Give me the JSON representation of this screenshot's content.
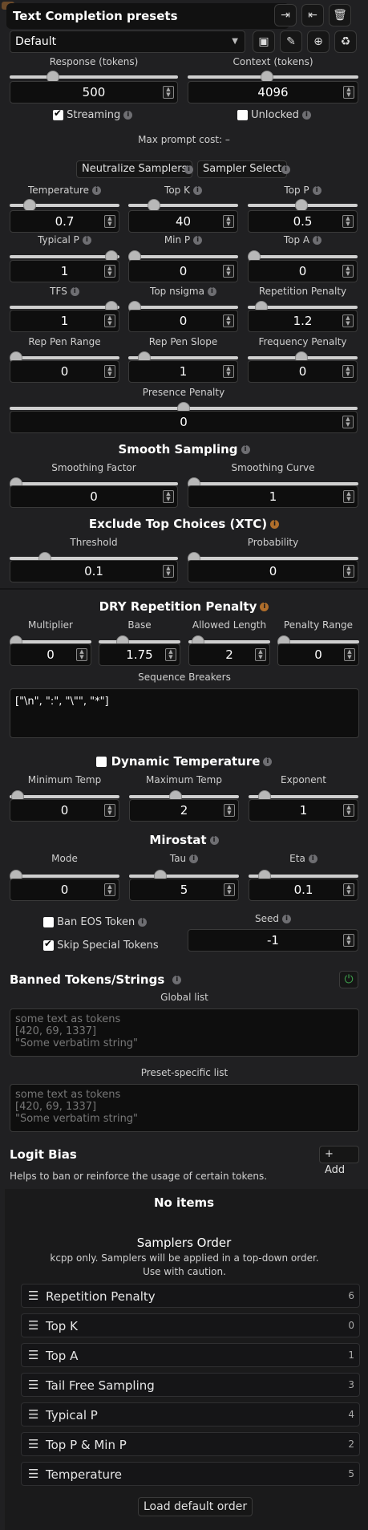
{
  "header": {
    "title": "Text Completion presets",
    "icons": [
      "import-icon",
      "export-icon",
      "trash-icon"
    ]
  },
  "preset": {
    "selected": "Default",
    "icons": [
      "save-icon",
      "pencil-icon",
      "new-file-icon",
      "recycle-icon"
    ]
  },
  "response": {
    "label": "Response (tokens)",
    "value": "500"
  },
  "context": {
    "label": "Context (tokens)",
    "value": "4096"
  },
  "streaming": {
    "label": "Streaming",
    "checked": true
  },
  "unlocked": {
    "label": "Unlocked",
    "checked": false
  },
  "max_prompt_cost": "Max prompt cost: –",
  "buttons": {
    "neutralize": "Neutralize Samplers",
    "sampler_select": "Sampler Select"
  },
  "sliders": {
    "temperature": {
      "label": "Temperature",
      "value": "0.7"
    },
    "top_k": {
      "label": "Top K",
      "value": "40"
    },
    "top_p": {
      "label": "Top P",
      "value": "0.5"
    },
    "typical_p": {
      "label": "Typical P",
      "value": "1"
    },
    "min_p": {
      "label": "Min P",
      "value": "0"
    },
    "top_a": {
      "label": "Top A",
      "value": "0"
    },
    "tfs": {
      "label": "TFS",
      "value": "1"
    },
    "top_nsigma": {
      "label": "Top nsigma",
      "value": "0"
    },
    "rep_pen": {
      "label": "Repetition Penalty",
      "value": "1.2"
    },
    "rep_pen_range": {
      "label": "Rep Pen Range",
      "value": "0"
    },
    "rep_pen_slope": {
      "label": "Rep Pen Slope",
      "value": "1"
    },
    "freq_pen": {
      "label": "Frequency Penalty",
      "value": "0"
    },
    "pres_pen": {
      "label": "Presence Penalty",
      "value": "0"
    }
  },
  "smooth": {
    "title": "Smooth Sampling",
    "factor": {
      "label": "Smoothing Factor",
      "value": "0"
    },
    "curve": {
      "label": "Smoothing Curve",
      "value": "1"
    }
  },
  "xtc": {
    "title": "Exclude Top Choices (XTC)",
    "threshold": {
      "label": "Threshold",
      "value": "0.1"
    },
    "probability": {
      "label": "Probability",
      "value": "0"
    }
  },
  "dry": {
    "title": "DRY Repetition Penalty",
    "multiplier": {
      "label": "Multiplier",
      "value": "0"
    },
    "base": {
      "label": "Base",
      "value": "1.75"
    },
    "allowed_length": {
      "label": "Allowed Length",
      "value": "2"
    },
    "penalty_range": {
      "label": "Penalty Range",
      "value": "0"
    },
    "seq_label": "Sequence Breakers",
    "seq_value": "[\"\\n\", \":\", \"\\\"\", \"*\"]"
  },
  "dyntemp": {
    "title": "Dynamic Temperature",
    "checked": false,
    "min": {
      "label": "Minimum Temp",
      "value": "0"
    },
    "max": {
      "label": "Maximum Temp",
      "value": "2"
    },
    "exp": {
      "label": "Exponent",
      "value": "1"
    }
  },
  "mirostat": {
    "title": "Mirostat",
    "mode": {
      "label": "Mode",
      "value": "0"
    },
    "tau": {
      "label": "Tau",
      "value": "5"
    },
    "eta": {
      "label": "Eta",
      "value": "0.1"
    }
  },
  "ban_eos": {
    "label": "Ban EOS Token",
    "checked": false
  },
  "skip_special": {
    "label": "Skip Special Tokens",
    "checked": true
  },
  "seed": {
    "label": "Seed",
    "value": "-1"
  },
  "banned": {
    "title": "Banned Tokens/Strings",
    "global_label": "Global list",
    "global_placeholder": "some text as tokens\n[420, 69, 1337]\n\"Some verbatim string\"",
    "preset_label": "Preset-specific list",
    "preset_placeholder": "some text as tokens\n[420, 69, 1337]\n\"Some verbatim string\""
  },
  "logit_bias": {
    "title": "Logit Bias",
    "add_label": "+ Add",
    "description": "Helps to ban or reinforce the usage of certain tokens.",
    "empty": "No items"
  },
  "samplers_order": {
    "title": "Samplers Order",
    "description": "kcpp only. Samplers will be applied in a top-down order. Use with caution.",
    "items": [
      {
        "label": "Repetition Penalty",
        "index": "6"
      },
      {
        "label": "Top K",
        "index": "0"
      },
      {
        "label": "Top A",
        "index": "1"
      },
      {
        "label": "Tail Free Sampling",
        "index": "3"
      },
      {
        "label": "Typical P",
        "index": "4"
      },
      {
        "label": "Top P & Min P",
        "index": "2"
      },
      {
        "label": "Temperature",
        "index": "5"
      }
    ],
    "load_default": "Load default order"
  },
  "colors": {
    "background": "#202022",
    "info_orange": "#b06e2b",
    "power_green": "#3fa34d"
  }
}
